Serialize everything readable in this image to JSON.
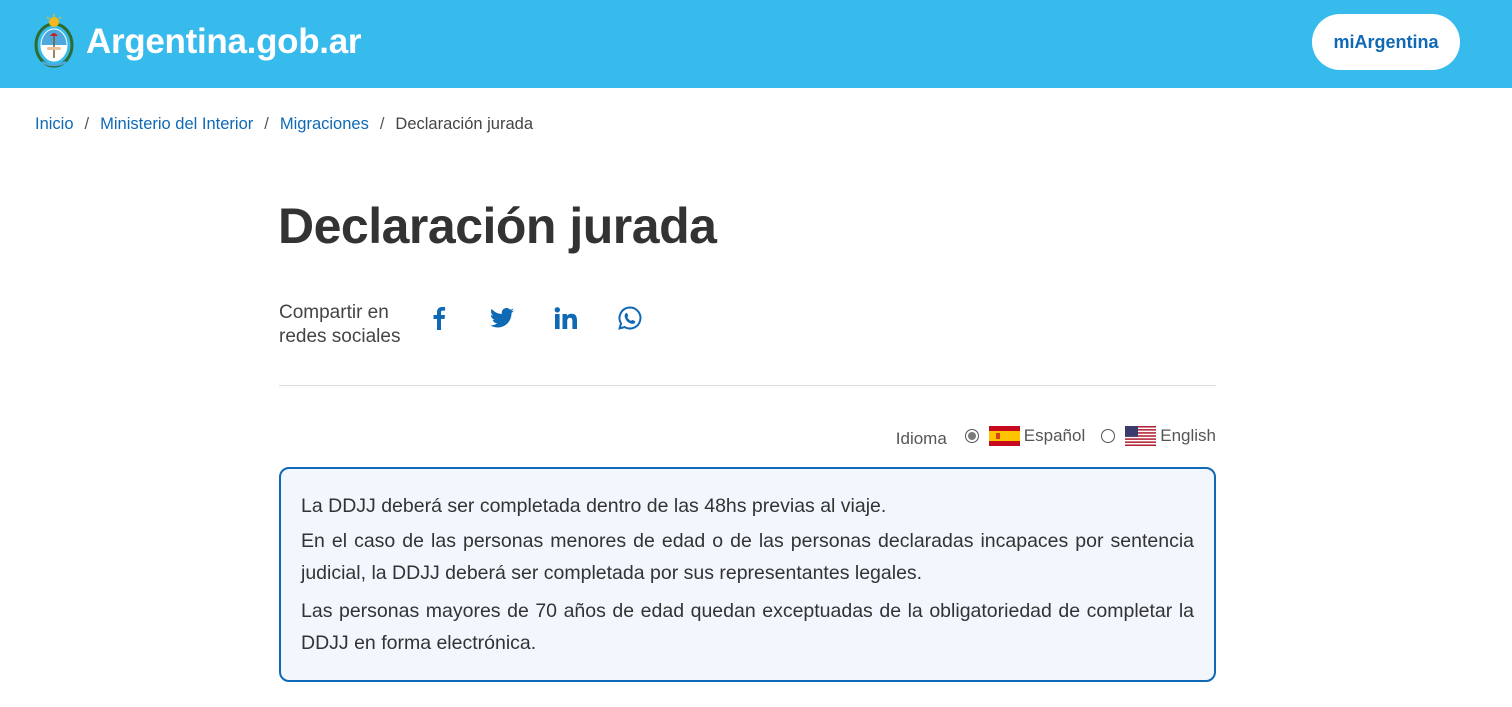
{
  "header": {
    "site_name": "Argentina.gob.ar",
    "mi_argentina_label": "miArgentina",
    "background_color": "#37bbed",
    "emblem_icon": "argentina-coat-of-arms-icon"
  },
  "breadcrumb": {
    "items": [
      "Inicio",
      "Ministerio del Interior",
      "Migraciones"
    ],
    "separator": "/",
    "current": "Declaración jurada"
  },
  "page": {
    "title": "Declaración jurada"
  },
  "share": {
    "label": "Compartir en redes sociales",
    "networks": [
      "facebook-icon",
      "twitter-icon",
      "linkedin-icon",
      "whatsapp-icon"
    ],
    "icon_color": "#0f69b4"
  },
  "language": {
    "label": "Idioma",
    "options": [
      {
        "name": "Español",
        "selected": true,
        "flag": "spain-flag-icon"
      },
      {
        "name": "English",
        "selected": false,
        "flag": "usa-flag-icon"
      }
    ]
  },
  "notice": {
    "border_color": "#0f69b4",
    "background_color": "#f1f7fd",
    "paragraphs": [
      "La DDJJ deberá ser completada dentro de las 48hs previas al viaje.",
      "En el caso de las personas menores de edad o de las personas declaradas incapaces por sentencia judicial, la DDJJ deberá ser completada por sus representantes legales.",
      "Las personas mayores de 70 años de edad quedan exceptuadas de la obligatoriedad de completar la DDJJ en forma electrónica."
    ]
  }
}
